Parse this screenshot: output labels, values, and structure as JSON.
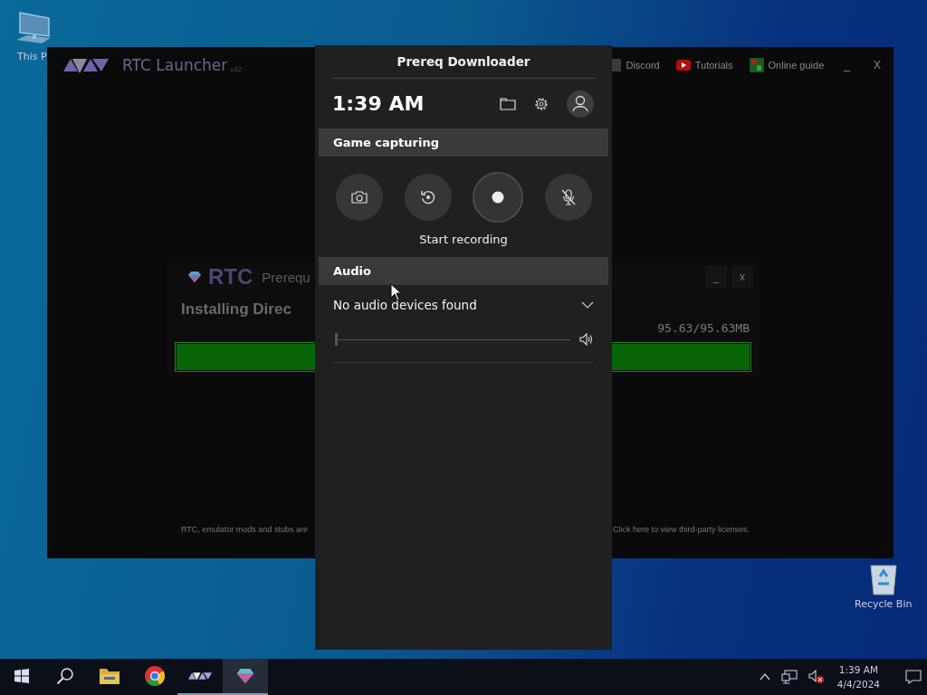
{
  "desktop": {
    "icons": [
      {
        "kind": "computer",
        "label": "This P"
      },
      {
        "kind": "recycle",
        "label": "Recycle Bin"
      }
    ]
  },
  "launcher": {
    "title": "RTC Launcher",
    "version": "v32",
    "links": [
      {
        "kind": "discord",
        "label": "Discord"
      },
      {
        "kind": "youtube",
        "label": "Tutorials"
      },
      {
        "kind": "guide",
        "label": "Online guide"
      }
    ],
    "controls": [
      "_",
      "X"
    ],
    "dialog": {
      "title": "RTC",
      "subtitle": "Prerequ",
      "controls": [
        "_",
        "x"
      ],
      "status": "Installing Direc",
      "progress_text": "95.63/95.63MB",
      "level": 1
    },
    "footer": {
      "notice": "RTC, emulator mods and stubs are",
      "licenses_link": "Click here to view third-party licenses."
    }
  },
  "game_bar": {
    "title": "Prereq Downloader",
    "time": "1:39 AM",
    "capture": {
      "heading": "Game capturing",
      "caption": "Start recording",
      "buttons": [
        {
          "kind": "screenshot",
          "selected": false
        },
        {
          "kind": "replay",
          "selected": false
        },
        {
          "kind": "record",
          "selected": true
        },
        {
          "kind": "mic",
          "selected": false,
          "muted": true
        }
      ]
    },
    "audio": {
      "heading": "Audio",
      "device": "No audio devices found",
      "level": 0
    }
  },
  "taskbar": {
    "apps": [
      {
        "kind": "explorer",
        "running": false,
        "selected": false
      },
      {
        "kind": "chrome",
        "running": false,
        "selected": false
      },
      {
        "kind": "rtc",
        "running": true,
        "selected": false
      },
      {
        "kind": "gem",
        "running": true,
        "selected": true
      }
    ],
    "volume_muted": true,
    "time": "1:39 AM",
    "date": "4/4/2024"
  }
}
